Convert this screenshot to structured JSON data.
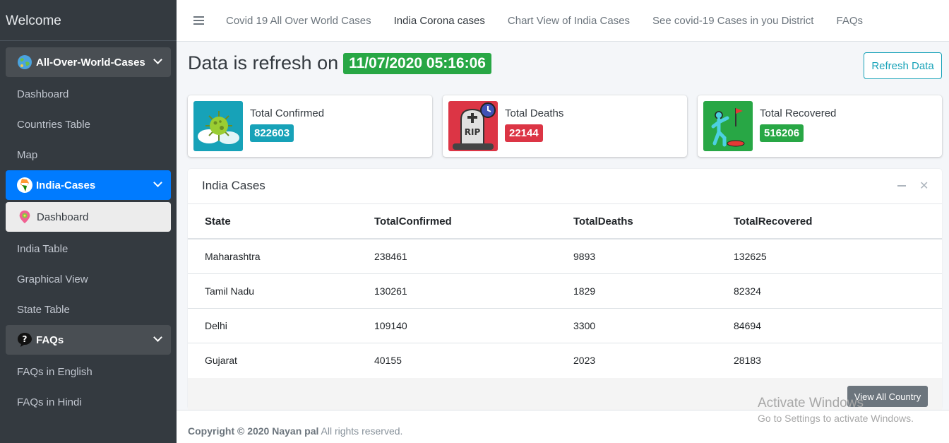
{
  "sidebar": {
    "brand": "Welcome",
    "groups": [
      {
        "label": "All-Over-World-Cases",
        "items": [
          "Dashboard",
          "Countries Table",
          "Map"
        ]
      },
      {
        "label": "India-Cases",
        "items": [
          "Dashboard",
          "India Table",
          "Graphical View",
          "State Table"
        ]
      },
      {
        "label": "FAQs",
        "items": [
          "FAQs in English",
          "FAQs in Hindi"
        ]
      }
    ]
  },
  "topnav": {
    "links": [
      "Covid 19 All Over World Cases",
      "India Corona cases",
      "Chart View of India Cases",
      "See covid-19 Cases in you District",
      "FAQs"
    ]
  },
  "header": {
    "title": "Data is refresh on",
    "timestamp": "11/07/2020 05:16:06",
    "refresh_button": "Refresh Data"
  },
  "stats": [
    {
      "label": "Total Confirmed",
      "value": "822603",
      "color": "#17a2b8"
    },
    {
      "label": "Total Deaths",
      "value": "22144",
      "color": "#dc3545"
    },
    {
      "label": "Total Recovered",
      "value": "516206",
      "color": "#28a745"
    }
  ],
  "cases_card": {
    "title": "India Cases",
    "columns": [
      "State",
      "TotalConfirmed",
      "TotalDeaths",
      "TotalRecovered"
    ],
    "rows": [
      [
        "Maharashtra",
        "238461",
        "9893",
        "132625"
      ],
      [
        "Tamil Nadu",
        "130261",
        "1829",
        "82324"
      ],
      [
        "Delhi",
        "109140",
        "3300",
        "84694"
      ],
      [
        "Gujarat",
        "40155",
        "2023",
        "28183"
      ]
    ],
    "view_all_button": "View All Country"
  },
  "footer": {
    "copyright": "Copyright © 2020 Nayan pal",
    "rights": " All rights reserved."
  },
  "watermark": {
    "line1": "Activate Windows",
    "line2": "Go to Settings to activate Windows."
  }
}
